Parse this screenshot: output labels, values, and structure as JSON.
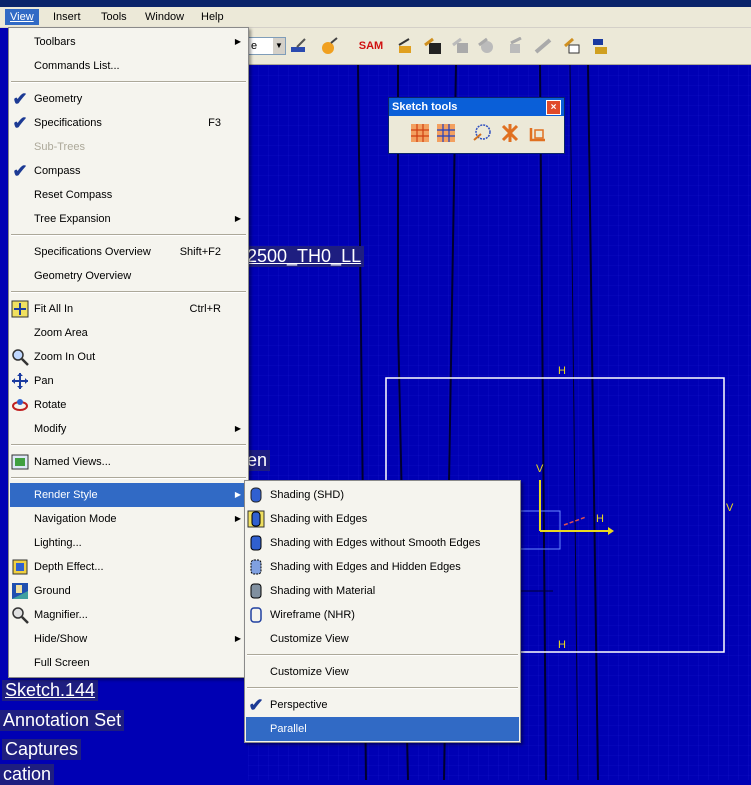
{
  "menubar": {
    "items": [
      {
        "label": "View"
      },
      {
        "label": "Insert"
      },
      {
        "label": "Tools"
      },
      {
        "label": "Window"
      },
      {
        "label": "Help"
      }
    ]
  },
  "toolbar": {
    "combo_value": "e",
    "sam_label": "SAM"
  },
  "view_menu": {
    "items": [
      {
        "label": "Toolbars",
        "shortcut": "",
        "submenu": true
      },
      {
        "label": "Commands List...",
        "shortcut": ""
      },
      {
        "label": "Geometry",
        "shortcut": "",
        "checked": true
      },
      {
        "label": "Specifications",
        "shortcut": "F3",
        "checked": true
      },
      {
        "label": "Sub-Trees",
        "shortcut": "",
        "disabled": true
      },
      {
        "label": "Compass",
        "shortcut": "",
        "checked": true
      },
      {
        "label": "Reset Compass",
        "shortcut": ""
      },
      {
        "label": "Tree Expansion",
        "shortcut": "",
        "submenu": true
      },
      {
        "label": "Specifications Overview",
        "shortcut": "Shift+F2"
      },
      {
        "label": "Geometry Overview",
        "shortcut": ""
      },
      {
        "label": "Fit All In",
        "shortcut": "Ctrl+R"
      },
      {
        "label": "Zoom Area",
        "shortcut": ""
      },
      {
        "label": "Zoom In Out",
        "shortcut": ""
      },
      {
        "label": "Pan",
        "shortcut": ""
      },
      {
        "label": "Rotate",
        "shortcut": ""
      },
      {
        "label": "Modify",
        "shortcut": "",
        "submenu": true
      },
      {
        "label": "Named Views...",
        "shortcut": ""
      },
      {
        "label": "Render Style",
        "shortcut": "",
        "submenu": true,
        "selected": true
      },
      {
        "label": "Navigation Mode",
        "shortcut": "",
        "submenu": true
      },
      {
        "label": "Lighting...",
        "shortcut": ""
      },
      {
        "label": "Depth Effect...",
        "shortcut": ""
      },
      {
        "label": "Ground",
        "shortcut": ""
      },
      {
        "label": "Magnifier...",
        "shortcut": ""
      },
      {
        "label": "Hide/Show",
        "shortcut": "",
        "submenu": true
      },
      {
        "label": "Full Screen",
        "shortcut": ""
      }
    ]
  },
  "render_menu": {
    "items": [
      {
        "label": "Shading (SHD)"
      },
      {
        "label": "Shading with Edges"
      },
      {
        "label": "Shading with Edges without Smooth Edges"
      },
      {
        "label": "Shading with Edges and Hidden Edges"
      },
      {
        "label": "Shading with Material"
      },
      {
        "label": "Wireframe (NHR)"
      },
      {
        "label": "Customize View"
      },
      {
        "label": "Customize View"
      },
      {
        "label": "Perspective",
        "checked": true
      },
      {
        "label": "Parallel",
        "selected": true
      }
    ]
  },
  "sketch_tools": {
    "title": "Sketch tools",
    "close": "×"
  },
  "tree": {
    "label_2500": "2500_TH0_LL",
    "label_en": "en",
    "sketch": "Sketch.144",
    "annotation": "Annotation Set",
    "captures": "Captures",
    "cation": "cation"
  },
  "canvas_labels": {
    "h_top": "H",
    "h_bottom": "H",
    "v_right": "V",
    "v_axis": "V",
    "h_axis": "H"
  }
}
